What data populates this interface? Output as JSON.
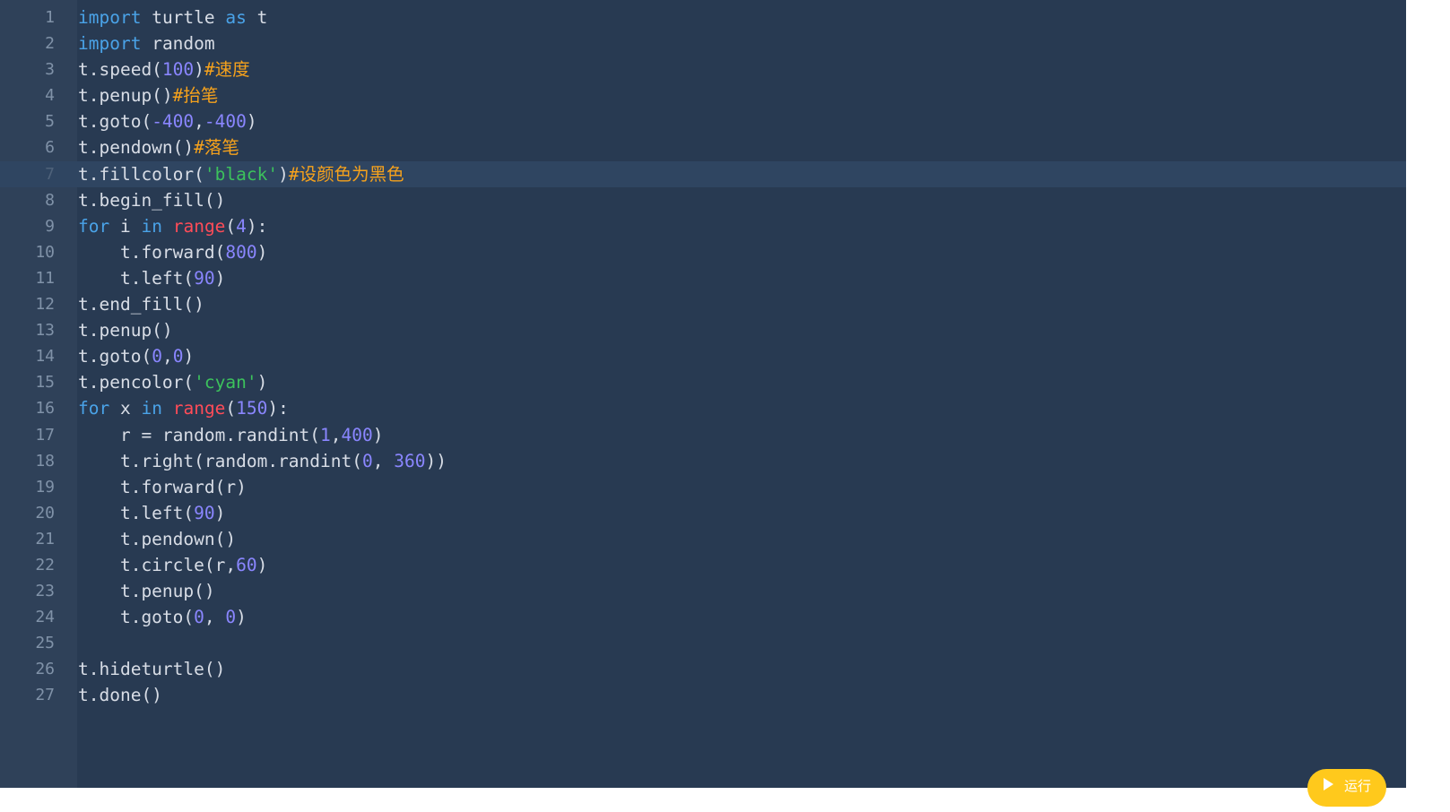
{
  "editor": {
    "active_line": 7,
    "lines": [
      {
        "n": "1",
        "tokens": [
          [
            "kw",
            "import"
          ],
          [
            "",
            "turtle"
          ],
          [
            "kw",
            "as"
          ],
          [
            "",
            "t"
          ]
        ],
        "sep": [
          " ",
          " ",
          " "
        ]
      },
      {
        "n": "2",
        "tokens": [
          [
            "kw",
            "import"
          ],
          [
            "",
            "random"
          ]
        ],
        "sep": [
          " "
        ]
      },
      {
        "n": "3",
        "tokens": [
          [
            "",
            "t.speed("
          ],
          [
            "num",
            "100"
          ],
          [
            "",
            ")"
          ],
          [
            "cm",
            "#速度"
          ]
        ]
      },
      {
        "n": "4",
        "tokens": [
          [
            "",
            "t.penup()"
          ],
          [
            "cm",
            "#抬笔"
          ]
        ]
      },
      {
        "n": "5",
        "tokens": [
          [
            "",
            "t.goto("
          ],
          [
            "num",
            "-400"
          ],
          [
            "",
            ","
          ],
          [
            "num",
            "-400"
          ],
          [
            "",
            ")"
          ]
        ]
      },
      {
        "n": "6",
        "tokens": [
          [
            "",
            "t.pendown()"
          ],
          [
            "cm",
            "#落笔"
          ]
        ]
      },
      {
        "n": "7",
        "tokens": [
          [
            "",
            "t.fillcolor("
          ],
          [
            "str",
            "'black'"
          ],
          [
            "",
            ")"
          ],
          [
            "cm",
            "#设颜色为黑色"
          ]
        ]
      },
      {
        "n": "8",
        "tokens": [
          [
            "",
            "t.begin_fill()"
          ]
        ]
      },
      {
        "n": "9",
        "tokens": [
          [
            "kw",
            "for"
          ],
          [
            "",
            ""
          ],
          [
            "",
            "i"
          ],
          [
            "",
            ""
          ],
          [
            "kw",
            "in"
          ],
          [
            "",
            ""
          ],
          [
            "bi",
            "range"
          ],
          [
            "",
            "("
          ],
          [
            "num",
            "4"
          ],
          [
            "",
            "):"
          ]
        ],
        "spaced": true
      },
      {
        "n": "10",
        "tokens": [
          [
            "",
            "    t.forward("
          ],
          [
            "num",
            "800"
          ],
          [
            "",
            ")"
          ]
        ]
      },
      {
        "n": "11",
        "tokens": [
          [
            "",
            "    t.left("
          ],
          [
            "num",
            "90"
          ],
          [
            "",
            ")"
          ]
        ]
      },
      {
        "n": "12",
        "tokens": [
          [
            "",
            "t.end_fill()"
          ]
        ]
      },
      {
        "n": "13",
        "tokens": [
          [
            "",
            "t.penup()"
          ]
        ]
      },
      {
        "n": "14",
        "tokens": [
          [
            "",
            "t.goto("
          ],
          [
            "num",
            "0"
          ],
          [
            "",
            ","
          ],
          [
            "num",
            "0"
          ],
          [
            "",
            ")"
          ]
        ]
      },
      {
        "n": "15",
        "tokens": [
          [
            "",
            "t.pencolor("
          ],
          [
            "str",
            "'cyan'"
          ],
          [
            "",
            ")"
          ]
        ]
      },
      {
        "n": "16",
        "tokens": [
          [
            "kw",
            "for"
          ],
          [
            "",
            ""
          ],
          [
            "",
            "x"
          ],
          [
            "",
            ""
          ],
          [
            "kw",
            "in"
          ],
          [
            "",
            ""
          ],
          [
            "bi",
            "range"
          ],
          [
            "",
            "("
          ],
          [
            "num",
            "150"
          ],
          [
            "",
            "):"
          ]
        ],
        "spaced": true
      },
      {
        "n": "17",
        "tokens": [
          [
            "",
            "    r = random.randint("
          ],
          [
            "num",
            "1"
          ],
          [
            "",
            ","
          ],
          [
            "num",
            "400"
          ],
          [
            "",
            ")"
          ]
        ]
      },
      {
        "n": "18",
        "tokens": [
          [
            "",
            "    t.right(random.randint("
          ],
          [
            "num",
            "0"
          ],
          [
            "",
            ", "
          ],
          [
            "num",
            "360"
          ],
          [
            "",
            "))"
          ]
        ]
      },
      {
        "n": "19",
        "tokens": [
          [
            "",
            "    t.forward(r)"
          ]
        ]
      },
      {
        "n": "20",
        "tokens": [
          [
            "",
            "    t.left("
          ],
          [
            "num",
            "90"
          ],
          [
            "",
            ")"
          ]
        ]
      },
      {
        "n": "21",
        "tokens": [
          [
            "",
            "    t.pendown()"
          ]
        ]
      },
      {
        "n": "22",
        "tokens": [
          [
            "",
            "    t.circle(r,"
          ],
          [
            "num",
            "60"
          ],
          [
            "",
            ")"
          ]
        ]
      },
      {
        "n": "23",
        "tokens": [
          [
            "",
            "    t.penup()"
          ]
        ]
      },
      {
        "n": "24",
        "tokens": [
          [
            "",
            "    t.goto("
          ],
          [
            "num",
            "0"
          ],
          [
            "",
            ", "
          ],
          [
            "num",
            "0"
          ],
          [
            "",
            ")"
          ]
        ]
      },
      {
        "n": "25",
        "tokens": []
      },
      {
        "n": "26",
        "tokens": [
          [
            "",
            "t.hideturtle()"
          ]
        ]
      },
      {
        "n": "27",
        "tokens": [
          [
            "",
            "t.done()"
          ]
        ]
      }
    ]
  },
  "run_button": {
    "label": "运行",
    "icon": "play-icon",
    "color": "#ffc91c"
  },
  "colors": {
    "background": "#283a52",
    "gutter": "#2f4159",
    "keyword": "#4aa3e8",
    "builtin": "#ff4c58",
    "number": "#8a86ff",
    "string": "#3cc25c",
    "comment": "#f6a21c"
  }
}
